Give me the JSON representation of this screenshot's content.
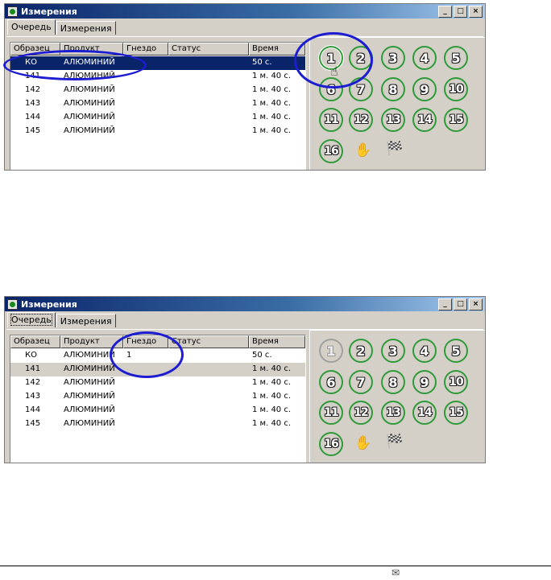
{
  "window": {
    "title": "Измерения",
    "controls": {
      "minimize": "_",
      "maximize": "□",
      "close": "×"
    },
    "tabs": [
      "Очередь",
      "Измерения"
    ]
  },
  "columns": [
    "Образец",
    "Продукт",
    "Гнездо",
    "Статус",
    "Время"
  ],
  "panel1": {
    "rows": [
      {
        "sample": "КО",
        "product": "АЛЮМИНИЙ",
        "slot": "",
        "status": "",
        "time": "50 с."
      },
      {
        "sample": "141",
        "product": "АЛЮМИНИЙ",
        "slot": "",
        "status": "",
        "time": "1 м. 40 с."
      },
      {
        "sample": "142",
        "product": "АЛЮМИНИЙ",
        "slot": "",
        "status": "",
        "time": "1 м. 40 с."
      },
      {
        "sample": "143",
        "product": "АЛЮМИНИЙ",
        "slot": "",
        "status": "",
        "time": "1 м. 40 с."
      },
      {
        "sample": "144",
        "product": "АЛЮМИНИЙ",
        "slot": "",
        "status": "",
        "time": "1 м. 40 с."
      },
      {
        "sample": "145",
        "product": "АЛЮМИНИЙ",
        "slot": "",
        "status": "",
        "time": "1 м. 40 с."
      }
    ]
  },
  "panel2": {
    "rows": [
      {
        "sample": "КО",
        "product": "АЛЮМИНИЙ",
        "slot": "1",
        "status": "",
        "time": "50 с."
      },
      {
        "sample": "141",
        "product": "АЛЮМИНИЙ",
        "slot": "",
        "status": "",
        "time": "1 м. 40 с."
      },
      {
        "sample": "142",
        "product": "АЛЮМИНИЙ",
        "slot": "",
        "status": "",
        "time": "1 м. 40 с."
      },
      {
        "sample": "143",
        "product": "АЛЮМИНИЙ",
        "slot": "",
        "status": "",
        "time": "1 м. 40 с."
      },
      {
        "sample": "144",
        "product": "АЛЮМИНИЙ",
        "slot": "",
        "status": "",
        "time": "1 м. 40 с."
      },
      {
        "sample": "145",
        "product": "АЛЮМИНИЙ",
        "slot": "",
        "status": "",
        "time": "1 м. 40 с."
      }
    ]
  },
  "position_buttons": [
    "1",
    "2",
    "3",
    "4",
    "5",
    "6",
    "7",
    "8",
    "9",
    "10",
    "11",
    "12",
    "13",
    "14",
    "15",
    "16"
  ],
  "tools": {
    "hand": "hand-icon",
    "finish": "checkered-flag-icon"
  },
  "colors": {
    "button_ring": "#2f9a3a",
    "highlight": "#1c1cd0",
    "selection": "#0a246a"
  }
}
